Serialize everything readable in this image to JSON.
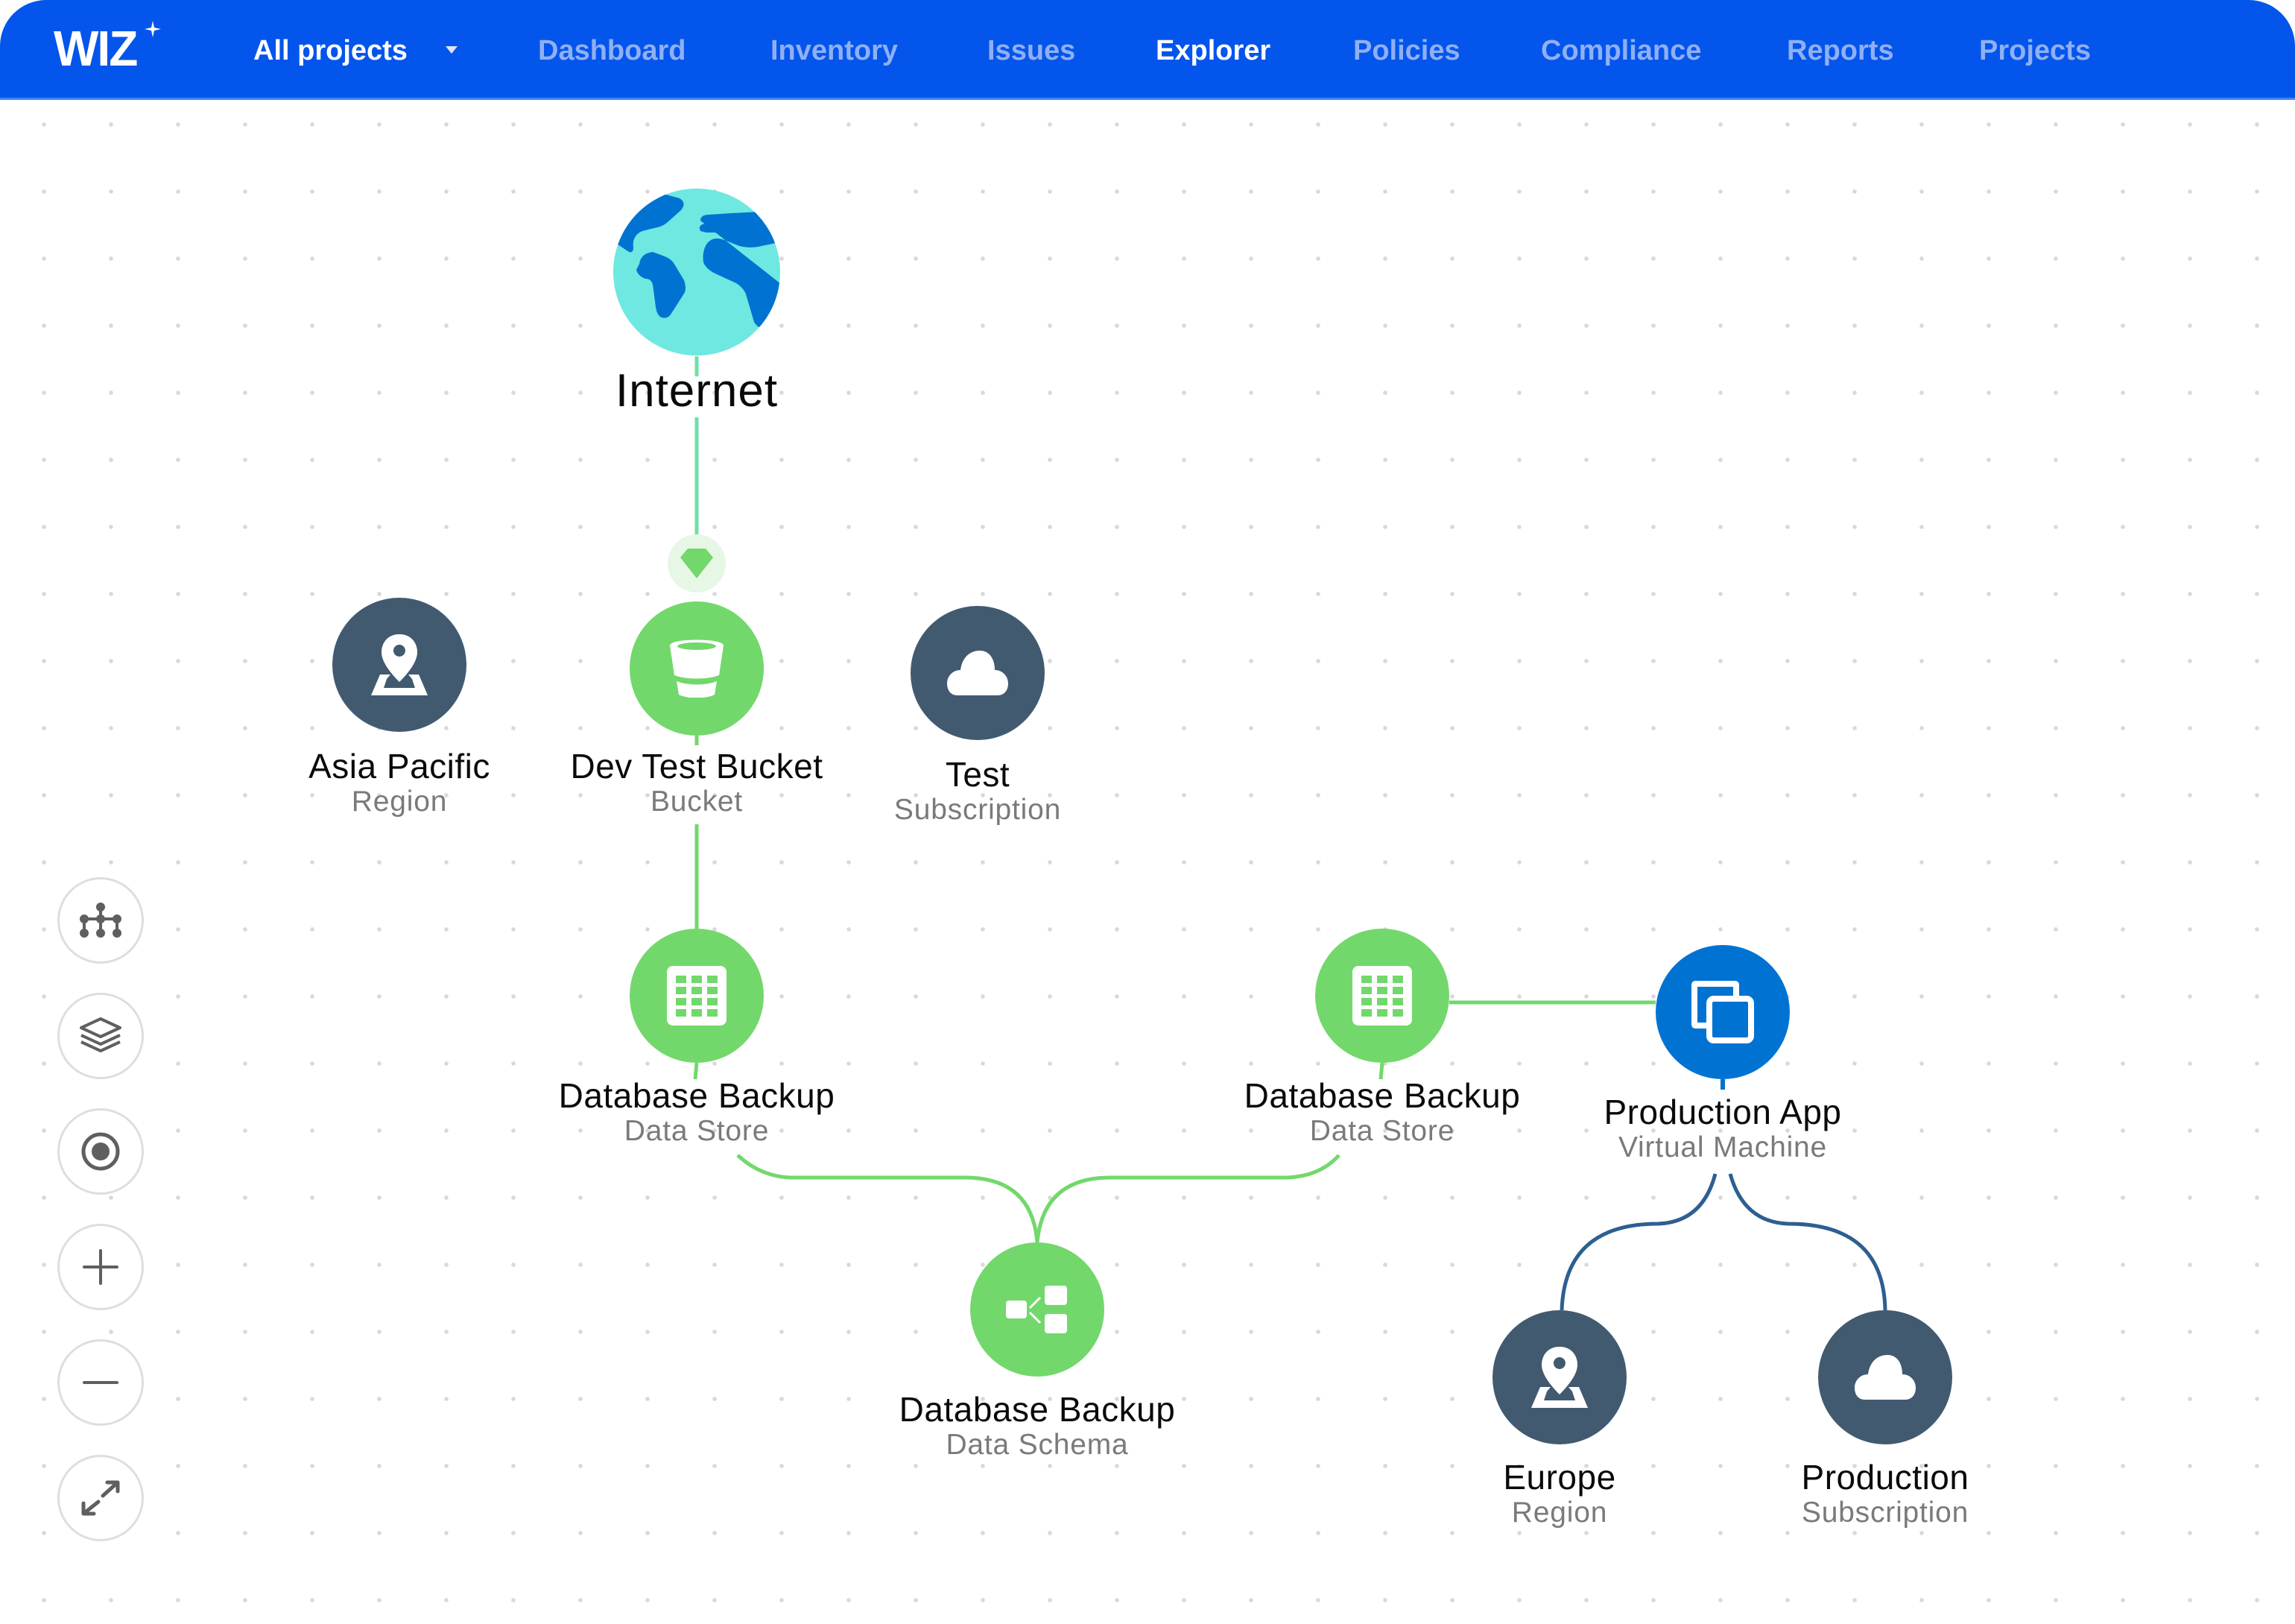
{
  "header": {
    "logo": "WIZ",
    "project_selector": "All projects",
    "nav": [
      {
        "label": "Dashboard",
        "active": false
      },
      {
        "label": "Inventory",
        "active": false
      },
      {
        "label": "Issues",
        "active": false
      },
      {
        "label": "Explorer",
        "active": true
      },
      {
        "label": "Policies",
        "active": false
      },
      {
        "label": "Compliance",
        "active": false
      },
      {
        "label": "Reports",
        "active": false
      },
      {
        "label": "Projects",
        "active": false
      }
    ]
  },
  "colors": {
    "brand_blue": "#0455EB",
    "nav_inactive": "#8FB0F5",
    "node_green": "#72D86B",
    "node_slate": "#425A70",
    "node_blue": "#0073D2",
    "edge_green": "#72D86B",
    "edge_blue": "#2D5F91",
    "globe_land": "#0073D2",
    "globe_water": "#6EE8E0"
  },
  "graph": {
    "internet": {
      "title": "Internet",
      "icon": "globe-icon"
    },
    "exposure_badge": {
      "icon": "diamond-icon"
    },
    "nodes": [
      {
        "id": "asia-pacific",
        "title": "Asia Pacific",
        "subtitle": "Region",
        "icon": "map-pin-icon",
        "kind": "slate"
      },
      {
        "id": "dev-test-bucket",
        "title": "Dev Test Bucket",
        "subtitle": "Bucket",
        "icon": "bucket-icon",
        "kind": "green"
      },
      {
        "id": "test",
        "title": "Test",
        "subtitle": "Subscription",
        "icon": "cloud-icon",
        "kind": "slate"
      },
      {
        "id": "db-backup-left",
        "title": "Database Backup",
        "subtitle": "Data Store",
        "icon": "table-icon",
        "kind": "green"
      },
      {
        "id": "db-backup-right",
        "title": "Database Backup",
        "subtitle": "Data Store",
        "icon": "table-icon",
        "kind": "green"
      },
      {
        "id": "production-app",
        "title": "Production App",
        "subtitle": "Virtual Machine",
        "icon": "vm-icon",
        "kind": "blue"
      },
      {
        "id": "db-schema",
        "title": "Database Backup",
        "subtitle": "Data Schema",
        "icon": "schema-icon",
        "kind": "green"
      },
      {
        "id": "europe",
        "title": "Europe",
        "subtitle": "Region",
        "icon": "map-pin-icon",
        "kind": "slate"
      },
      {
        "id": "production",
        "title": "Production",
        "subtitle": "Subscription",
        "icon": "cloud-icon",
        "kind": "slate"
      }
    ],
    "edges": [
      [
        "internet",
        "dev-test-bucket"
      ],
      [
        "asia-pacific",
        "dev-test-bucket"
      ],
      [
        "dev-test-bucket",
        "test"
      ],
      [
        "dev-test-bucket",
        "db-backup-left"
      ],
      [
        "db-backup-left",
        "db-schema"
      ],
      [
        "db-backup-right",
        "db-schema"
      ],
      [
        "db-backup-right",
        "production-app"
      ],
      [
        "production-app",
        "europe"
      ],
      [
        "production-app",
        "production"
      ]
    ]
  },
  "controls": [
    {
      "name": "hierarchy-layout-button",
      "icon": "hierarchy-icon"
    },
    {
      "name": "layers-button",
      "icon": "layers-icon"
    },
    {
      "name": "focus-button",
      "icon": "target-icon"
    },
    {
      "name": "zoom-in-button",
      "icon": "plus-icon"
    },
    {
      "name": "zoom-out-button",
      "icon": "minus-icon"
    },
    {
      "name": "fit-screen-button",
      "icon": "expand-icon"
    }
  ]
}
